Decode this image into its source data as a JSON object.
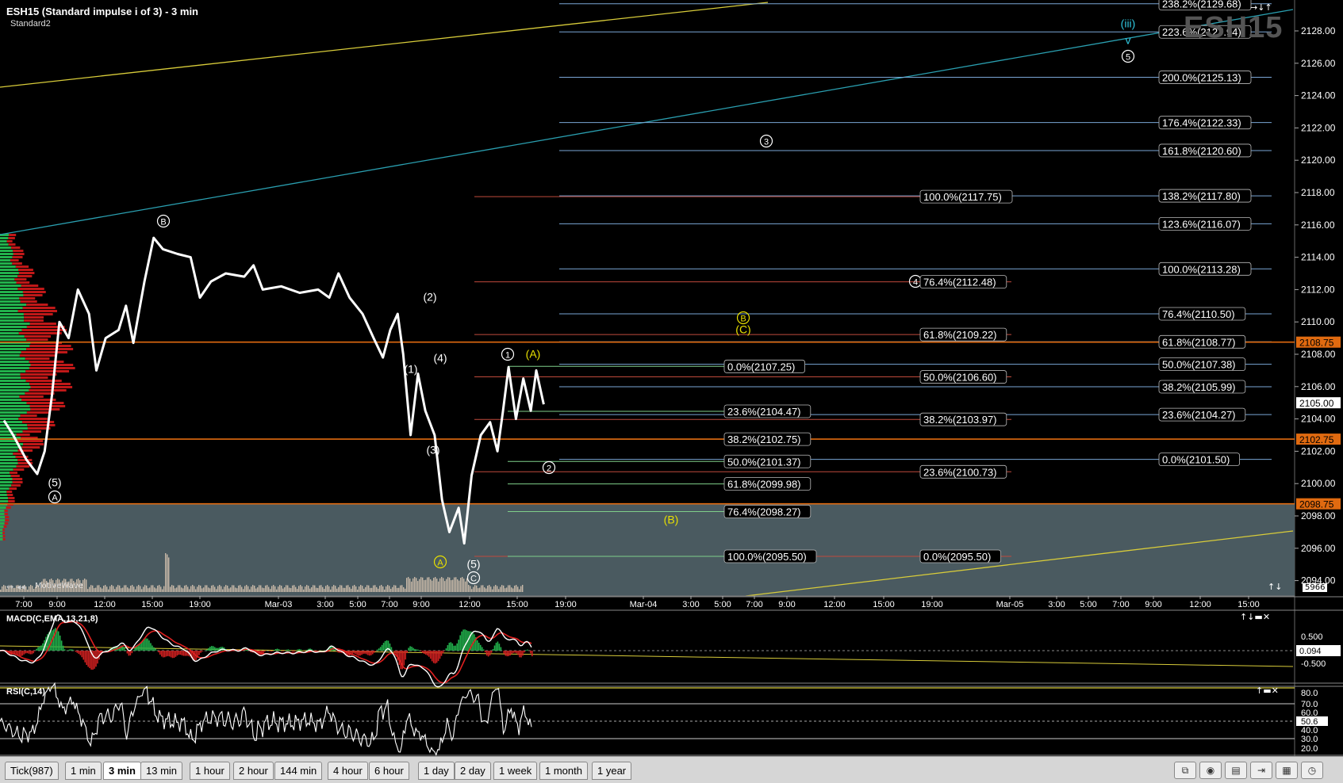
{
  "window": {
    "title": "ESH15 (Standard impulse i of 3) - 3 min",
    "subtitle": "Standard2",
    "symbol_watermark": "ESH15",
    "volume_indicator_label": "MotiveWave",
    "volume_readout": "5966"
  },
  "chart_data": {
    "type": "line",
    "price_axis": {
      "range": [
        2093.0,
        2130.5
      ],
      "ticks": [
        2094.0,
        2096.0,
        2098.0,
        2100.0,
        2102.0,
        2104.0,
        2106.0,
        2108.0,
        2110.0,
        2112.0,
        2114.0,
        2116.0,
        2118.0,
        2120.0,
        2122.0,
        2124.0,
        2126.0,
        2128.0
      ],
      "highlighted_levels": [
        {
          "value": "2108.75",
          "color": "#e06a10"
        },
        {
          "value": "2105.00",
          "color": "#ffffff"
        },
        {
          "value": "2102.75",
          "color": "#e06a10"
        },
        {
          "value": "2098.75",
          "color": "#e06a10"
        }
      ]
    },
    "time_axis": {
      "labels": [
        "7:00",
        "9:00",
        "12:00",
        "15:00",
        "19:00",
        "Mar-03",
        "3:00",
        "5:00",
        "7:00",
        "9:00",
        "12:00",
        "15:00",
        "19:00",
        "Mar-04",
        "3:00",
        "5:00",
        "7:00",
        "9:00",
        "12:00",
        "15:00",
        "19:00",
        "Mar-05",
        "3:00",
        "5:00",
        "7:00",
        "9:00",
        "12:00",
        "15:00"
      ]
    },
    "price_series": [
      [
        0,
        2103.9
      ],
      [
        0.5,
        2103.0
      ],
      [
        1.2,
        2101.5
      ],
      [
        1.8,
        2100.6
      ],
      [
        2.2,
        2102.0
      ],
      [
        2.6,
        2105.5
      ],
      [
        3.0,
        2110.0
      ],
      [
        3.5,
        2109.0
      ],
      [
        4.0,
        2112.0
      ],
      [
        4.6,
        2110.5
      ],
      [
        5.0,
        2107.0
      ],
      [
        5.5,
        2109.0
      ],
      [
        6.2,
        2109.5
      ],
      [
        6.6,
        2111.0
      ],
      [
        7.0,
        2108.7
      ],
      [
        7.6,
        2112.5
      ],
      [
        8.1,
        2115.2
      ],
      [
        8.6,
        2114.5
      ],
      [
        9.4,
        2114.2
      ],
      [
        10.1,
        2114.0
      ],
      [
        10.6,
        2111.5
      ],
      [
        11.2,
        2112.5
      ],
      [
        12.0,
        2113.0
      ],
      [
        13.0,
        2112.8
      ],
      [
        13.5,
        2113.5
      ],
      [
        14.0,
        2112.0
      ],
      [
        15.0,
        2112.2
      ],
      [
        16.0,
        2111.8
      ],
      [
        17.0,
        2112.0
      ],
      [
        17.6,
        2111.5
      ],
      [
        18.1,
        2113.0
      ],
      [
        18.7,
        2111.5
      ],
      [
        19.4,
        2110.5
      ],
      [
        20.0,
        2109.0
      ],
      [
        20.5,
        2107.8
      ],
      [
        20.9,
        2109.5
      ],
      [
        21.3,
        2110.5
      ],
      [
        21.6,
        2108.0
      ],
      [
        22.0,
        2103.0
      ],
      [
        22.4,
        2106.8
      ],
      [
        22.8,
        2104.5
      ],
      [
        23.3,
        2103.0
      ],
      [
        23.7,
        2099.0
      ],
      [
        24.1,
        2097.0
      ],
      [
        24.6,
        2098.5
      ],
      [
        24.9,
        2096.3
      ],
      [
        25.3,
        2100.5
      ],
      [
        25.8,
        2103.0
      ],
      [
        26.3,
        2103.8
      ],
      [
        26.7,
        2102.0
      ],
      [
        27.0,
        2104.5
      ],
      [
        27.3,
        2107.2
      ],
      [
        27.7,
        2104.0
      ],
      [
        28.1,
        2106.5
      ],
      [
        28.5,
        2104.5
      ],
      [
        28.8,
        2107.0
      ],
      [
        29.2,
        2104.9
      ]
    ],
    "fib_levels": [
      {
        "label": "238.2%(2129.68)",
        "value": 2129.68,
        "group": "blue"
      },
      {
        "label": "223.6%(2127.94)",
        "value": 2127.94,
        "group": "blue"
      },
      {
        "label": "200.0%(2125.13)",
        "value": 2125.13,
        "group": "blue"
      },
      {
        "label": "176.4%(2122.33)",
        "value": 2122.33,
        "group": "blue"
      },
      {
        "label": "161.8%(2120.60)",
        "value": 2120.6,
        "group": "blue"
      },
      {
        "label": "138.2%(2117.80)",
        "value": 2117.8,
        "group": "blue"
      },
      {
        "label": "123.6%(2116.07)",
        "value": 2116.07,
        "group": "blue"
      },
      {
        "label": "100.0%(2113.28)",
        "value": 2113.28,
        "group": "blue"
      },
      {
        "label": "76.4%(2110.50)",
        "value": 2110.5,
        "group": "blue"
      },
      {
        "label": "61.8%(2108.77)",
        "value": 2108.77,
        "group": "blue"
      },
      {
        "label": "50.0%(2107.38)",
        "value": 2107.38,
        "group": "blue"
      },
      {
        "label": "38.2%(2105.99)",
        "value": 2105.99,
        "group": "blue"
      },
      {
        "label": "23.6%(2104.27)",
        "value": 2104.27,
        "group": "blue"
      },
      {
        "label": "0.0%(2101.50)",
        "value": 2101.5,
        "group": "blue"
      },
      {
        "label": "100.0%(2117.75)",
        "value": 2117.75,
        "group": "red"
      },
      {
        "label": "76.4%(2112.48)",
        "value": 2112.48,
        "group": "red"
      },
      {
        "label": "61.8%(2109.22)",
        "value": 2109.22,
        "group": "red"
      },
      {
        "label": "50.0%(2106.60)",
        "value": 2106.6,
        "group": "red"
      },
      {
        "label": "38.2%(2103.97)",
        "value": 2103.97,
        "group": "red"
      },
      {
        "label": "23.6%(2100.73)",
        "value": 2100.73,
        "group": "red"
      },
      {
        "label": "0.0%(2095.50)",
        "value": 2095.5,
        "group": "red"
      },
      {
        "label": "0.0%(2107.25)",
        "value": 2107.25,
        "group": "green"
      },
      {
        "label": "23.6%(2104.47)",
        "value": 2104.47,
        "group": "green"
      },
      {
        "label": "38.2%(2102.75)",
        "value": 2102.75,
        "group": "green"
      },
      {
        "label": "50.0%(2101.37)",
        "value": 2101.37,
        "group": "green"
      },
      {
        "label": "61.8%(2099.98)",
        "value": 2099.98,
        "group": "green"
      },
      {
        "label": "76.4%(2098.27)",
        "value": 2098.27,
        "group": "green"
      },
      {
        "label": "100.0%(2095.50)",
        "value": 2095.5,
        "group": "green"
      }
    ],
    "wave_labels": [
      {
        "text": "B",
        "circled": true,
        "color": "#ffffff"
      },
      {
        "text": "(5)",
        "circled": false,
        "color": "#ffffff"
      },
      {
        "text": "A",
        "circled": true,
        "color": "#ffffff"
      },
      {
        "text": "(2)",
        "circled": false,
        "color": "#ffffff"
      },
      {
        "text": "(1)",
        "circled": false,
        "color": "#ffffff"
      },
      {
        "text": "(4)",
        "circled": false,
        "color": "#ffffff"
      },
      {
        "text": "(3)",
        "circled": false,
        "color": "#ffffff"
      },
      {
        "text": "(5)",
        "circled": false,
        "color": "#ffffff"
      },
      {
        "text": "C",
        "circled": true,
        "color": "#ffffff"
      },
      {
        "text": "A",
        "circled": true,
        "color": "#e8e000"
      },
      {
        "text": "1",
        "circled": true,
        "color": "#ffffff"
      },
      {
        "text": "(A)",
        "circled": false,
        "color": "#e8e000"
      },
      {
        "text": "2",
        "circled": true,
        "color": "#ffffff"
      },
      {
        "text": "B",
        "circled": true,
        "color": "#e8e000"
      },
      {
        "text": "(C)",
        "circled": false,
        "color": "#e8e000"
      },
      {
        "text": "(B)",
        "circled": false,
        "color": "#e8e000"
      },
      {
        "text": "3",
        "circled": true,
        "color": "#ffffff"
      },
      {
        "text": "4",
        "circled": true,
        "color": "#ffffff"
      },
      {
        "text": "(iii)",
        "circled": false,
        "color": "#30c8e0"
      },
      {
        "text": "v",
        "circled": false,
        "color": "#30c8e0"
      },
      {
        "text": "5",
        "circled": true,
        "color": "#ffffff"
      }
    ],
    "indicators": {
      "macd": {
        "label": "MACD(C,EMA,13,21,8)",
        "ticks": [
          "0.500",
          "-0.500"
        ],
        "current_value": "0.094"
      },
      "rsi": {
        "label": "RSI(C,14)",
        "ticks": [
          "80.0",
          "70.0",
          "60.0",
          "50.6",
          "40.0",
          "30.0",
          "20.0"
        ],
        "current_value": "50.6"
      }
    }
  },
  "tabs": [
    {
      "label": "Tick(987)",
      "active": false
    },
    {
      "label": "1 min",
      "active": false
    },
    {
      "label": "3 min",
      "active": true
    },
    {
      "label": "13 min",
      "active": false
    },
    {
      "label": "1 hour",
      "active": false
    },
    {
      "label": "2 hour",
      "active": false
    },
    {
      "label": "144 min",
      "active": false
    },
    {
      "label": "4 hour",
      "active": false
    },
    {
      "label": "6 hour",
      "active": false
    },
    {
      "label": "1 day",
      "active": false
    },
    {
      "label": "2 day",
      "active": false
    },
    {
      "label": "1 week",
      "active": false
    },
    {
      "label": "1 month",
      "active": false
    },
    {
      "label": "1 year",
      "active": false
    }
  ],
  "toolbar_icons": [
    "layout-icon",
    "eye-icon",
    "database-icon",
    "range-icon",
    "calendar-icon",
    "clock-icon"
  ],
  "colors": {
    "blue_fib": "#7aa6d6",
    "red_fib": "#c04a3c",
    "green_fib": "#7fcf8a",
    "trendline_yellow": "#d8cc3a",
    "trendline_cyan": "#2a9fb0",
    "orange_level": "#e06a10",
    "shaded_zone": "#4a5a60"
  }
}
